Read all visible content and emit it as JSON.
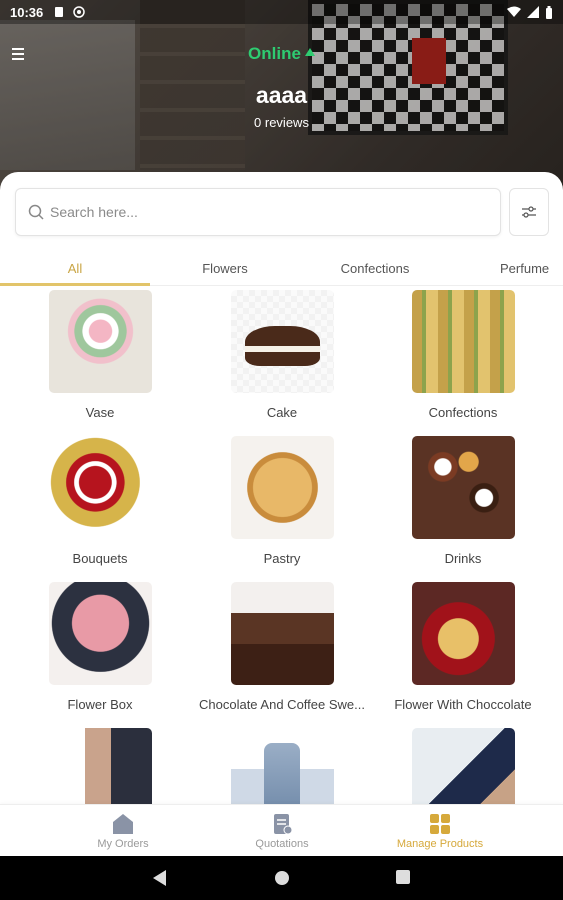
{
  "status_bar": {
    "time": "10:36"
  },
  "header": {
    "status": "Online",
    "store_name": "aaaa",
    "reviews": "0 reviews",
    "menu_icon": "hamburger-menu-icon"
  },
  "search": {
    "placeholder": "Search here...",
    "value": ""
  },
  "tabs": [
    {
      "label": "All",
      "active": true
    },
    {
      "label": "Flowers",
      "active": false
    },
    {
      "label": "Confections",
      "active": false
    },
    {
      "label": "Perfume",
      "active": false
    }
  ],
  "categories": [
    {
      "label": "Vase",
      "image": "flower-vase-image"
    },
    {
      "label": "Cake",
      "image": "chocolate-cake-image"
    },
    {
      "label": "Confections",
      "image": "baklava-tray-image"
    },
    {
      "label": "Bouquets",
      "image": "rose-bouquet-image"
    },
    {
      "label": "Pastry",
      "image": "quiche-pastry-image"
    },
    {
      "label": "Drinks",
      "image": "coffee-cups-image"
    },
    {
      "label": "Flower Box",
      "image": "pink-rose-box-image"
    },
    {
      "label": "Chocolate And Coffee Swe...",
      "image": "chocolate-cake-bar-image"
    },
    {
      "label": "Flower With Chocc­olate",
      "image": "flower-chocolate-arrangement-image"
    },
    {
      "label": "",
      "image": "man-with-perfume-image"
    },
    {
      "label": "",
      "image": "perfume-bottle-image"
    },
    {
      "label": "",
      "image": "perfume-spray-image"
    }
  ],
  "bottom_nav": [
    {
      "label": "My Orders",
      "icon": "home-icon",
      "active": false
    },
    {
      "label": "Quotations",
      "icon": "document-icon",
      "active": false
    },
    {
      "label": "Manage Products",
      "icon": "grid-icon",
      "active": true
    }
  ],
  "colors": {
    "accent": "#d6a93b",
    "online": "#2ecc71",
    "tab_underline": "#e2c46a"
  }
}
